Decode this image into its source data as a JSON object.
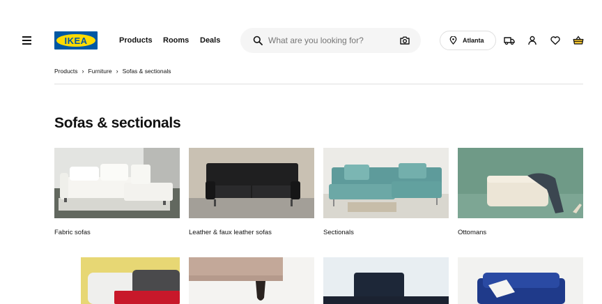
{
  "header": {
    "logo_text": "IKEA",
    "nav": [
      "Products",
      "Rooms",
      "Deals"
    ],
    "search_placeholder": "What are you looking for?",
    "location": "Atlanta",
    "icons": [
      "menu-icon",
      "search-icon",
      "camera-icon",
      "pin-icon",
      "truck-icon",
      "user-icon",
      "heart-icon",
      "basket-icon"
    ]
  },
  "breadcrumb": [
    "Products",
    "Furniture",
    "Sofas & sectionals"
  ],
  "breadcrumb_separator": "›",
  "page_title": "Sofas & sectionals",
  "categories": [
    {
      "label": "Fabric sofas"
    },
    {
      "label": "Leather & faux leather sofas"
    },
    {
      "label": "Sectionals"
    },
    {
      "label": "Ottomans"
    }
  ],
  "colors": {
    "ikea_blue": "#0058a3",
    "ikea_yellow": "#ffdb00",
    "search_bg": "#f5f5f5",
    "divider": "#dfdfdf"
  }
}
